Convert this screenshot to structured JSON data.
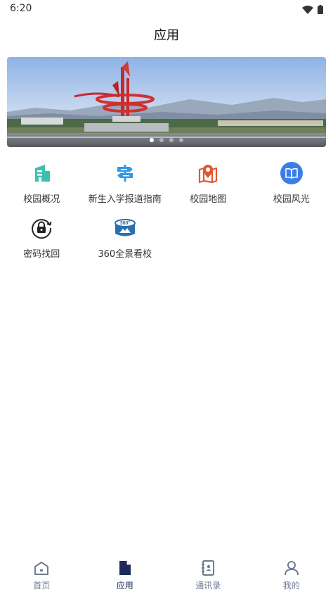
{
  "status_bar": {
    "time": "6:20",
    "icons": [
      "wifi-icon",
      "battery-icon"
    ]
  },
  "header": {
    "title": "应用"
  },
  "banner": {
    "slide_count": 4,
    "active_index": 0
  },
  "apps": [
    {
      "label": "校园概况",
      "icon": "building-icon",
      "color": "#3dbfb0"
    },
    {
      "label": "新生入学报道指南",
      "icon": "signpost-icon",
      "color": "#2f9ae6"
    },
    {
      "label": "校园地图",
      "icon": "map-pin-icon",
      "color": "#e4572e"
    },
    {
      "label": "校园风光",
      "icon": "book-icon",
      "color": "#3b7ee8"
    },
    {
      "label": "密码找回",
      "icon": "lock-reset-icon",
      "color": "#222222"
    },
    {
      "label": "360全景看校",
      "icon": "panorama-360-icon",
      "color": "#2a6fb0"
    }
  ],
  "bottom_nav": {
    "active": "应用",
    "items": [
      {
        "label": "首页",
        "icon": "home-icon"
      },
      {
        "label": "应用",
        "icon": "document-icon"
      },
      {
        "label": "通讯录",
        "icon": "contacts-icon"
      },
      {
        "label": "我的",
        "icon": "profile-icon"
      }
    ]
  },
  "colors": {
    "accent_dark": "#1c2b57",
    "nav_inactive": "#6f7c95"
  }
}
